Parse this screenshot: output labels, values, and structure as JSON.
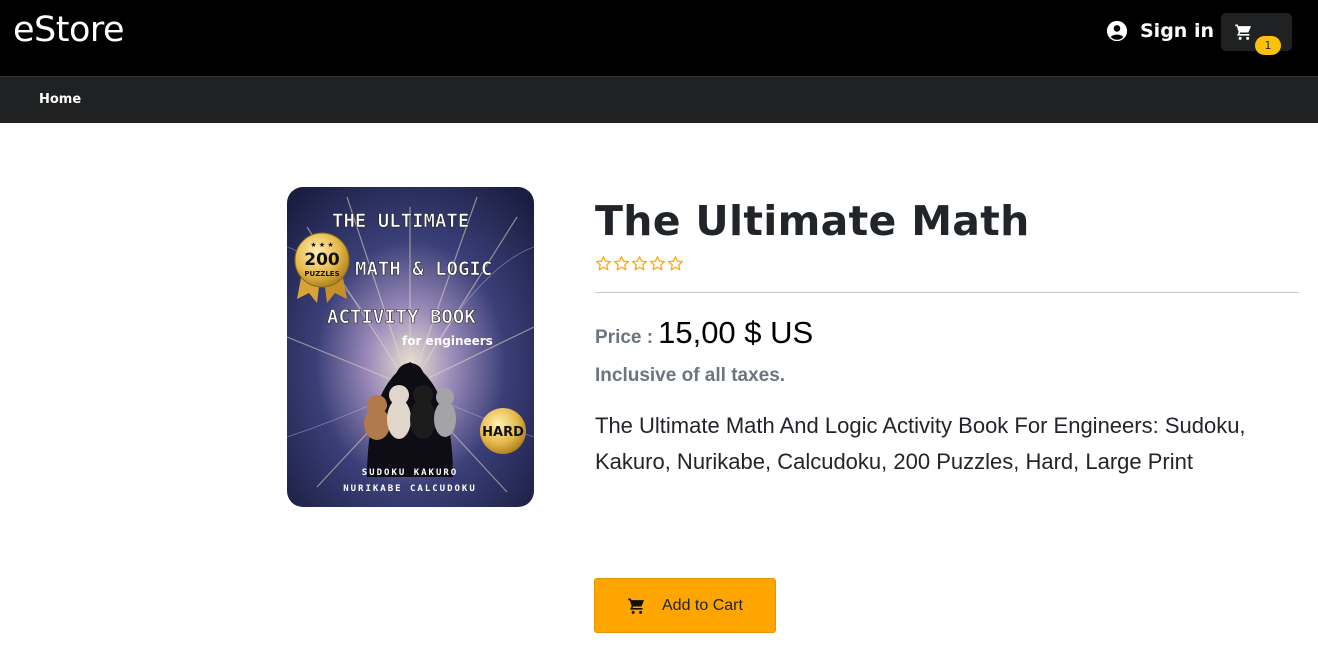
{
  "header": {
    "brand": "eStore",
    "signin_label": "Sign in",
    "cart_count": "1"
  },
  "nav": {
    "home_label": "Home"
  },
  "product": {
    "title": "The Ultimate Math",
    "rating": 0,
    "rating_max": 5,
    "price_label": "Price :",
    "price_value": "15,00 $ US",
    "taxes_note": "Inclusive of all taxes.",
    "description": "The Ultimate Math And Logic Activity Book For Engineers: Sudoku, Kakuro, Nurikabe, Calcudoku, 200 Puzzles, Hard, Large Print",
    "add_to_cart_label": "Add to Cart",
    "cover": {
      "line1": "THE ULTIMATE",
      "line2": "MATH & LOGIC",
      "line3": "ACTIVITY BOOK",
      "line4": "for engineers",
      "medal_number": "200",
      "medal_text": "PUZZLES",
      "level_badge": "HARD",
      "bottom_line1": "SUDOKU KAKURO",
      "bottom_line2": "NURIKABE CALCUDOKU"
    }
  },
  "colors": {
    "header_bg": "#000000",
    "nav_bg": "#202122",
    "accent": "#ffa500",
    "badge": "#ffc107",
    "star": "#ffa500"
  }
}
